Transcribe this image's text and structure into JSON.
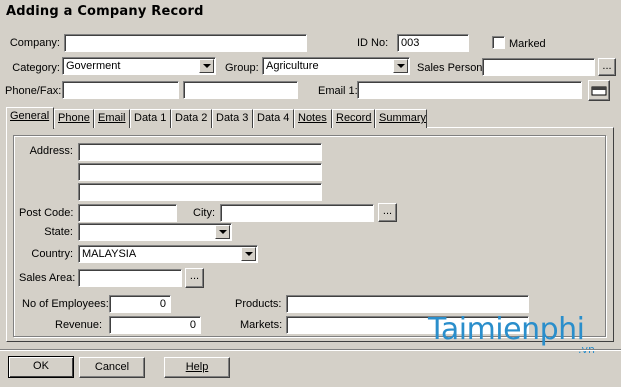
{
  "window": {
    "title": "Adding a Company Record"
  },
  "header": {
    "company_label": "Company:",
    "company_value": "",
    "id_label": "ID No:",
    "id_value": "003",
    "marked_label": "Marked",
    "category_label": "Category:",
    "category_value": "Goverment",
    "group_label": "Group:",
    "group_value": "Agriculture",
    "sales_person_label": "Sales Person:",
    "sales_person_value": "",
    "browse_label": "...",
    "phone_fax_label": "Phone/Fax:",
    "phone_value": "",
    "fax_value": "",
    "email1_label": "Email 1:",
    "email1_value": ""
  },
  "tabs": [
    {
      "label": "General"
    },
    {
      "label": "Phone"
    },
    {
      "label": "Email"
    },
    {
      "label": "Data 1"
    },
    {
      "label": "Data 2"
    },
    {
      "label": "Data 3"
    },
    {
      "label": "Data 4"
    },
    {
      "label": "Notes"
    },
    {
      "label": "Record"
    },
    {
      "label": "Summary"
    }
  ],
  "general": {
    "address_label": "Address:",
    "address_lines": [
      "",
      "",
      ""
    ],
    "post_code_label": "Post Code:",
    "post_code_value": "",
    "city_label": "City:",
    "city_value": "",
    "city_browse": "...",
    "state_label": "State:",
    "state_value": "",
    "country_label": "Country:",
    "country_value": "MALAYSIA",
    "sales_area_label": "Sales Area:",
    "sales_area_value": "",
    "sales_area_browse": "...",
    "employees_label": "No of Employees:",
    "employees_value": "0",
    "revenue_label": "Revenue:",
    "revenue_value": "0",
    "products_label": "Products:",
    "products_value": "",
    "markets_label": "Markets:",
    "markets_value": ""
  },
  "footer": {
    "ok_label": "OK",
    "cancel_label": "Cancel",
    "help_label": "Help"
  },
  "watermark": {
    "text": "Taimienphi",
    "sub": ".vn"
  }
}
